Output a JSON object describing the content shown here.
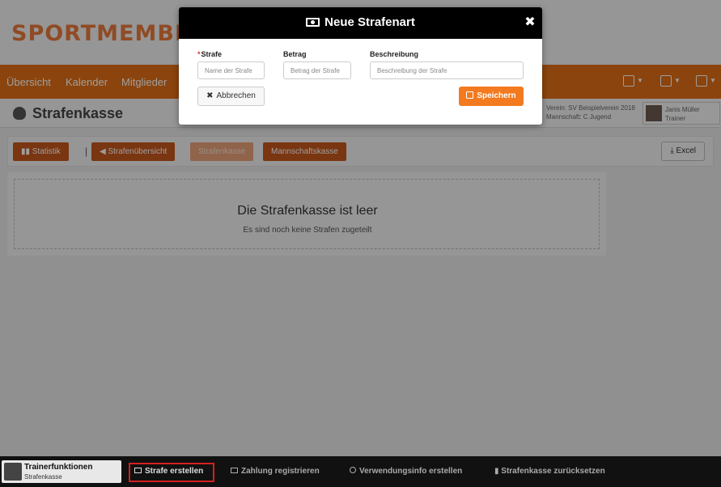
{
  "brand": {
    "logo_text": "SPORTMEMBER"
  },
  "nav": {
    "items": [
      {
        "label": "Übersicht"
      },
      {
        "label": "Kalender"
      },
      {
        "label": "Mitglieder"
      }
    ]
  },
  "subheader": {
    "title": "Strafenkasse",
    "club_line": "Verein: SV Beispielverein 2018",
    "team_line": "Mannschaft: C Jugend",
    "user_name": "Janis Müller",
    "user_role": "Trainer"
  },
  "tabs": {
    "statistik": "Statistik",
    "strafenuebersicht": "Strafenübersicht",
    "strafenkasse": "Strafenkasse",
    "mannschaftskasse": "Mannschaftskasse",
    "separator": "|",
    "excel": "Excel"
  },
  "empty_state": {
    "title": "Die Strafenkasse ist leer",
    "subtitle": "Es sind noch keine Strafen zugeteilt"
  },
  "modal": {
    "title": "Neue Strafenart",
    "close_symbol": "✖",
    "fields": {
      "strafe": {
        "label": "Strafe",
        "required_mark": "*",
        "placeholder": "Name der Strafe",
        "value": ""
      },
      "betrag": {
        "label": "Betrag",
        "placeholder": "Betrag der Strafe",
        "value": ""
      },
      "beschreibung": {
        "label": "Beschreibung",
        "placeholder": "Beschreibung der Strafe",
        "value": ""
      }
    },
    "cancel_label": "Abbrechen",
    "cancel_symbol": "✖",
    "save_label": "Speichern"
  },
  "bottom_bar": {
    "trainer_title": "Trainerfunktionen",
    "trainer_sub": "Strafenkasse",
    "actions": {
      "strafe_erstellen": "Strafe erstellen",
      "zahlung_registrieren": "Zahlung registrieren",
      "verwendungsinfo": "Verwendungsinfo erstellen",
      "zuruecksetzen": "Strafenkasse zurücksetzen"
    }
  },
  "colors": {
    "brand_orange": "#e06f16",
    "save_button": "#f37a1f",
    "highlight": "#d42020"
  }
}
